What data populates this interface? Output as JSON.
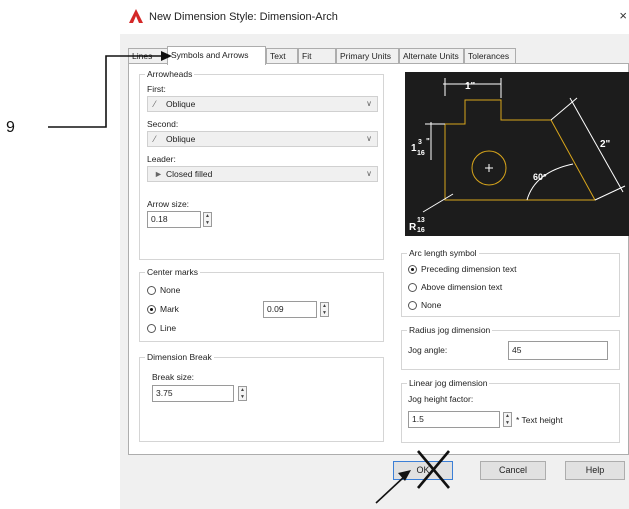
{
  "annotation": {
    "step_number": "9"
  },
  "dialog": {
    "title": "New Dimension Style: Dimension-Arch",
    "close_glyph": "×",
    "tabs": [
      {
        "label": "Lines"
      },
      {
        "label": "Symbols and Arrows"
      },
      {
        "label": "Text"
      },
      {
        "label": "Fit"
      },
      {
        "label": "Primary Units"
      },
      {
        "label": "Alternate Units"
      },
      {
        "label": "Tolerances"
      }
    ],
    "active_tab": "Symbols and Arrows"
  },
  "arrowheads": {
    "group_label": "Arrowheads",
    "first_label": "First:",
    "first_value": "Oblique",
    "second_label": "Second:",
    "second_value": "Oblique",
    "leader_label": "Leader:",
    "leader_value": "Closed filled",
    "arrow_size_label": "Arrow size:",
    "arrow_size_value": "0.18"
  },
  "center_marks": {
    "group_label": "Center marks",
    "options": [
      {
        "label": "None",
        "selected": false
      },
      {
        "label": "Mark",
        "selected": true
      },
      {
        "label": "Line",
        "selected": false
      }
    ],
    "size_value": "0.09"
  },
  "dimension_break": {
    "group_label": "Dimension Break",
    "break_size_label": "Break size:",
    "break_size_value": "3.75"
  },
  "preview": {
    "dim_top": "1\"",
    "dim_left_whole": "1",
    "dim_left_num": "3",
    "dim_left_den": "16",
    "dim_left_unit": "\"",
    "dim_right": "2\"",
    "dim_angle": "60°",
    "dim_radius_prefix": "R",
    "dim_radius_num": "13",
    "dim_radius_den": "16",
    "line_color": "#d9a61b"
  },
  "arc_length": {
    "group_label": "Arc length symbol",
    "options": [
      {
        "label": "Preceding dimension text",
        "selected": true
      },
      {
        "label": "Above dimension text",
        "selected": false
      },
      {
        "label": "None",
        "selected": false
      }
    ]
  },
  "radius_jog": {
    "group_label": "Radius jog dimension",
    "jog_angle_label": "Jog angle:",
    "jog_angle_value": "45"
  },
  "linear_jog": {
    "group_label": "Linear jog dimension",
    "jog_height_label": "Jog height factor:",
    "jog_height_value": "1.5",
    "suffix": "* Text height"
  },
  "buttons": {
    "ok": "OK",
    "cancel": "Cancel",
    "help": "Help"
  },
  "colors": {
    "autocad_logo": "#d42727",
    "preview_background": "#1c1c1c"
  }
}
